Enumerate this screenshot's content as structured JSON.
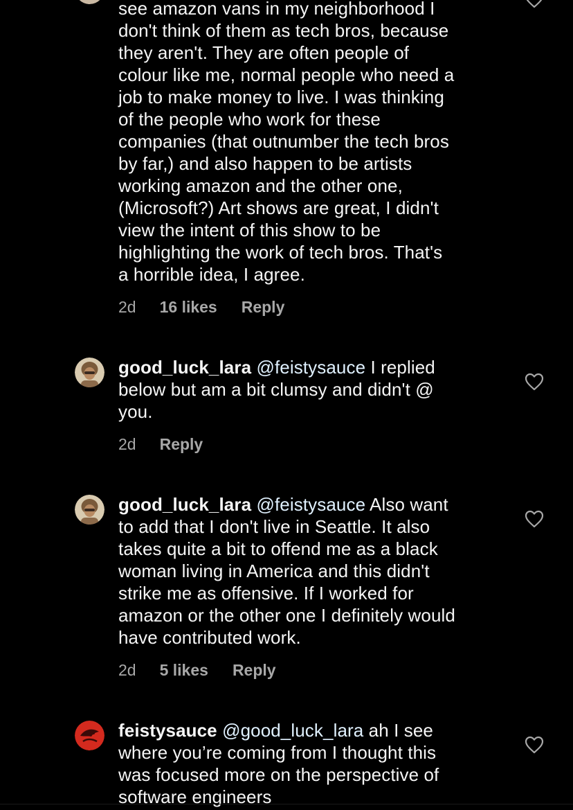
{
  "colors": {
    "background": "#000000",
    "text": "#f5f5f5",
    "meta": "#a8a8a8",
    "mention": "#e0f1ff"
  },
  "comments": [
    {
      "username": "",
      "text_lines": [
        "see amazon vans in my neighborhood I",
        "don't think of them as tech bros, because",
        "they aren't. They are often people of",
        "colour like me, normal people who need a",
        "job to make money to live. I was thinking",
        "of the people who work for these",
        "companies (that outnumber the tech bros",
        "by far,) and also happen to be artists",
        "working amazon and the other one,",
        "(Microsoft?) Art shows are great, I didn't",
        "view the intent of this show to be",
        "highlighting the work of tech bros.  That's",
        "a horrible idea, I agree."
      ],
      "time": "2d",
      "likes": "16 likes",
      "reply": "Reply",
      "like_icon": "heart-outline-icon"
    },
    {
      "username": "good_luck_lara",
      "mention": "@feistysauce",
      "text_first": " I replied",
      "text_lines": [
        "below but am a bit clumsy and didn't @",
        "you."
      ],
      "time": "2d",
      "reply": "Reply",
      "like_icon": "heart-outline-icon"
    },
    {
      "username": "good_luck_lara",
      "mention": "@feistysauce",
      "text_first": " Also want",
      "text_lines": [
        "to add that I don't live in Seattle. It also",
        "takes quite a bit to offend me as a black",
        "woman living in America and this didn't",
        "strike me as offensive. If I worked for",
        "amazon or the other one I definitely would",
        "have contributed work."
      ],
      "time": "2d",
      "likes": "5 likes",
      "reply": "Reply",
      "like_icon": "heart-outline-icon"
    },
    {
      "username": "feistysauce",
      "mention": "@good_luck_lara",
      "text_first": " ah I see",
      "text_lines": [
        "where you’re coming from I thought this",
        "was focused more on the perspective of",
        "software engineers"
      ],
      "like_icon": "heart-outline-icon"
    }
  ]
}
